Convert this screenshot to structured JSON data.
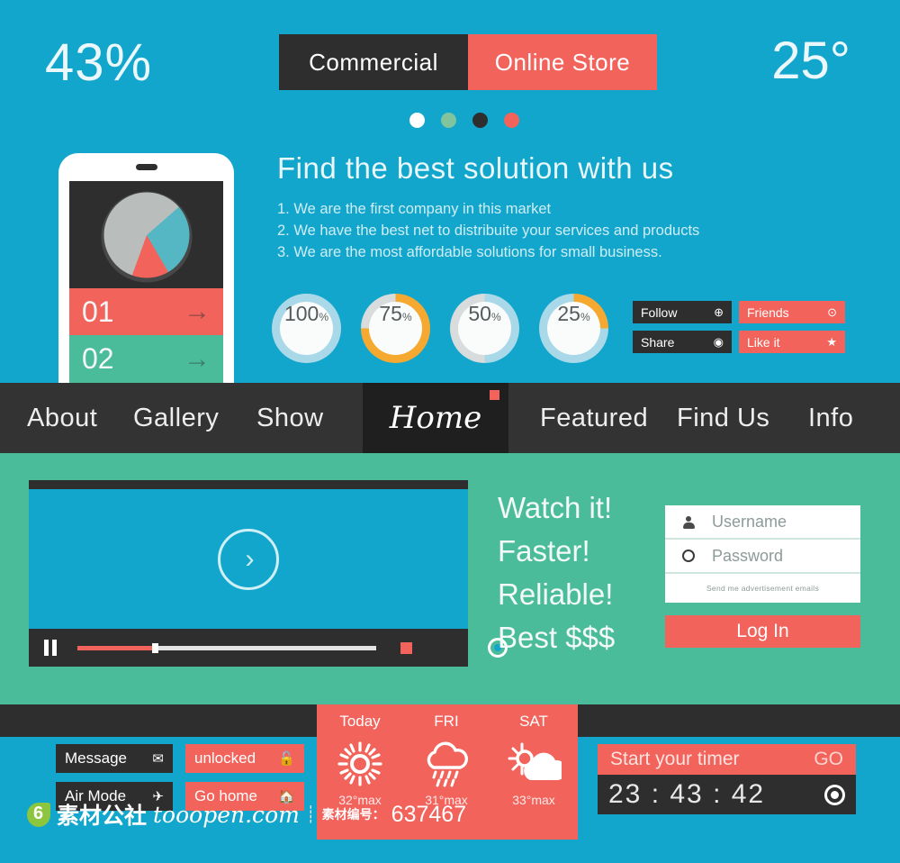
{
  "header": {
    "percent_left": "43%",
    "degrees_right": "25°",
    "toggle": {
      "left_label": "Commercial",
      "right_label": "Online Store"
    },
    "dots": [
      "white",
      "green",
      "dark",
      "coral"
    ]
  },
  "phone": {
    "chart": {
      "type": "pie",
      "labels": [
        "Gray",
        "Teal",
        "Coral"
      ],
      "values": [
        58,
        28,
        14
      ],
      "colors": [
        "#B9BDBC",
        "#56B7C4",
        "#F2635C"
      ]
    },
    "rows": [
      {
        "number": "01",
        "arrow": "→"
      },
      {
        "number": "02",
        "arrow": "→"
      }
    ]
  },
  "hero": {
    "headline": "Find the best solution with us",
    "bullets": [
      "1. We are the first company in this market",
      "2. We have the best net to distribuite your services and products",
      "3. We are the most affordable solutions for small business."
    ]
  },
  "progress_circles": [
    {
      "value": "100",
      "unit": "%",
      "percent": 100,
      "ring_color": "#A9D9E8",
      "track_color": "#D8DCDC"
    },
    {
      "value": "75",
      "unit": "%",
      "percent": 75,
      "ring_color": "#F5A930",
      "track_color": "#D8DCDC"
    },
    {
      "value": "50",
      "unit": "%",
      "percent": 50,
      "ring_color": "#A9D9E8",
      "track_color": "#D8DCDC"
    },
    {
      "value": "25",
      "unit": "%",
      "percent": 25,
      "ring_color": "#F5A930",
      "track_color": "#A9D9E8"
    }
  ],
  "social": [
    {
      "label": "Follow",
      "icon": "⊕",
      "icon_name": "plus-circle-icon",
      "style": "dark"
    },
    {
      "label": "Friends",
      "icon": "⊙",
      "icon_name": "target-circle-icon",
      "style": "coral"
    },
    {
      "label": "Share",
      "icon": "◉",
      "icon_name": "share-circle-icon",
      "style": "dark"
    },
    {
      "label": "Like it",
      "icon": "★",
      "icon_name": "star-icon",
      "style": "coral"
    }
  ],
  "nav": {
    "left_items": [
      "About",
      "Gallery",
      "Show"
    ],
    "active_item": "Home",
    "right_items": [
      "Featured",
      "Find Us",
      "Info"
    ]
  },
  "player": {
    "play_glyph": "›",
    "progress_percent": 25,
    "pause_label": "pause",
    "stop_label": "stop",
    "record_label": "record"
  },
  "watch": {
    "lines": [
      "Watch it!",
      "Faster!",
      "Reliable!",
      "Best $$$"
    ]
  },
  "login": {
    "username_placeholder": "Username",
    "password_placeholder": "Password",
    "checkbox_label": "Send me advertisement emails",
    "submit_label": "Log In"
  },
  "bottom_buttons": [
    {
      "label": "Message",
      "icon": "✉",
      "icon_name": "envelope-icon",
      "style": "dark"
    },
    {
      "label": "unlocked",
      "icon": "🔓",
      "icon_name": "unlock-icon",
      "style": "coral"
    },
    {
      "label": "Air Mode",
      "icon": "✈",
      "icon_name": "airplane-icon",
      "style": "dark"
    },
    {
      "label": "Go home",
      "icon": "🏠",
      "icon_name": "house-icon",
      "style": "coral"
    }
  ],
  "weather": [
    {
      "day": "Today",
      "icon": "sun-icon",
      "temp": "32°max"
    },
    {
      "day": "FRI",
      "icon": "rain-cloud-icon",
      "temp": "31°max"
    },
    {
      "day": "SAT",
      "icon": "sun-cloud-icon",
      "temp": "33°max"
    }
  ],
  "timer": {
    "title": "Start your timer",
    "go_label": "GO",
    "clock": "23 : 43 : 42"
  },
  "watermark": {
    "site_cn": "素材公社",
    "domain": "tooopen.com",
    "separator": "┊",
    "id_label": "素材编号：",
    "id_number": "637467"
  },
  "colors": {
    "blue": "#12A6CC",
    "green": "#4BBC99",
    "coral": "#F2635C",
    "dark": "#2E2E2E",
    "orange": "#F5A930"
  }
}
